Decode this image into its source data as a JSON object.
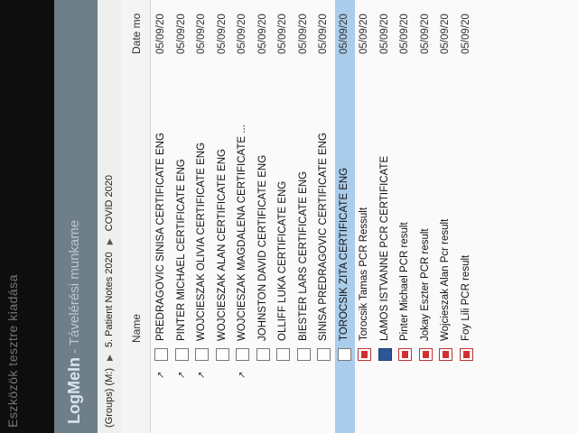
{
  "window": {
    "title": "Eszközök tesztre kiadása"
  },
  "logmein": {
    "brand": "LogMeIn",
    "subtitle": "- Távelérési munkame"
  },
  "breadcrumb": {
    "items": [
      "(Groups) (M:)",
      "5. Patient Notes 2020",
      "COVID 2020"
    ]
  },
  "columns": {
    "name": "Name",
    "date": "Date mo"
  },
  "files": [
    {
      "name": "PREDRAGOVIC SINISA CERTIFICATE ENG",
      "date": "05/09/20",
      "icon": "document-icon",
      "pinned": true
    },
    {
      "name": "PINTER MICHAEL CERTIFICATE ENG",
      "date": "05/09/20",
      "icon": "document-icon",
      "pinned": true
    },
    {
      "name": "WOJCIESZAK OLIVIA CERTIFICATE ENG",
      "date": "05/09/20",
      "icon": "document-icon",
      "pinned": true
    },
    {
      "name": "WOJCIESZAK ALAN CERTIFICATE ENG",
      "date": "05/09/20",
      "icon": "document-icon",
      "pinned": false
    },
    {
      "name": "WOJCIESZAK MAGDALENA CERTIFICATE ...",
      "date": "05/09/20",
      "icon": "document-icon",
      "pinned": true
    },
    {
      "name": "JOHNSTON DAVID CERTIFICATE ENG",
      "date": "05/09/20",
      "icon": "document-icon",
      "pinned": false
    },
    {
      "name": "OLLIFF LUKA CERTIFICATE ENG",
      "date": "05/09/20",
      "icon": "document-icon",
      "pinned": false
    },
    {
      "name": "BIESTER LARS CERTIFICATE ENG",
      "date": "05/09/20",
      "icon": "document-icon",
      "pinned": false
    },
    {
      "name": "SINISA  PREDRAGOVIC CERTIFICATE ENG",
      "date": "05/09/20",
      "icon": "document-icon",
      "pinned": false
    },
    {
      "name": "TOROCSIK ZITA CERTIFICATE ENG",
      "date": "05/09/20",
      "icon": "document-icon",
      "pinned": false,
      "selected": true
    },
    {
      "name": "Torocsik Tamas PCR Ressult",
      "date": "05/09/20",
      "icon": "pdf-icon",
      "pinned": false
    },
    {
      "name": "LAMOS ISTVANNE PCR CERTIFICATE",
      "date": "05/09/20",
      "icon": "word-icon",
      "pinned": false
    },
    {
      "name": "Pinter Michael PCR result",
      "date": "05/09/20",
      "icon": "pdf-icon",
      "pinned": false
    },
    {
      "name": "Jokay Eszter PCR result",
      "date": "05/09/20",
      "icon": "pdf-icon",
      "pinned": false
    },
    {
      "name": "Wojcieszak Alan Pcr result",
      "date": "05/09/20",
      "icon": "pdf-icon",
      "pinned": false
    },
    {
      "name": "Foy Lili PCR result",
      "date": "05/09/20",
      "icon": "pdf-icon",
      "pinned": false
    }
  ],
  "colors": {
    "selection": "#a9cdea",
    "titlebar": "#6f7f8a",
    "pdf": "#d12f2f"
  }
}
